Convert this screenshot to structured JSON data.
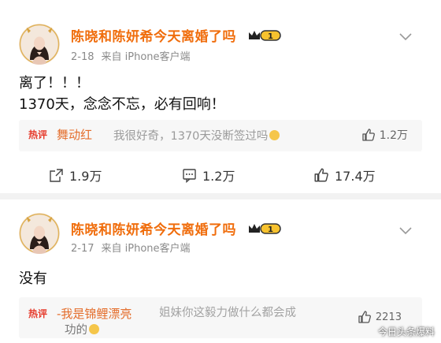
{
  "posts": [
    {
      "username": "陈晓和陈妍希今天离婚了吗",
      "vip_level": "1",
      "date": "2-18",
      "source": "来自 iPhone客户端",
      "text_line1": "离了！！！",
      "text_line2": "1370天，念念不忘，必有回响！",
      "hot_comment": {
        "tag": "热评",
        "author": "舞动红",
        "text": "我很好奇，1370天没断签过吗",
        "likes": "1.2万"
      },
      "actions": {
        "share": "1.9万",
        "comments": "1.2万",
        "likes": "17.4万"
      }
    },
    {
      "username": "陈晓和陈妍希今天离婚了吗",
      "vip_level": "1",
      "date": "2-17",
      "source": "来自 iPhone客户端",
      "text_line1": "没有",
      "hot_comment": {
        "tag": "热评",
        "author": "-我是锦鲤漂亮",
        "text": "姐妹你这毅力做什么都会成",
        "text_tail": "功的",
        "likes": "2213"
      }
    }
  ],
  "watermark": "今日头条爆料",
  "icons": {
    "badge": "vip-crown-icon",
    "menu": "chevron-down-icon",
    "share": "share-icon",
    "comment": "comment-icon",
    "like": "thumbs-up-icon"
  },
  "colors": {
    "username": "#f06d0c",
    "hot_tag": "#e63a2b",
    "meta": "#8a8a8a"
  }
}
